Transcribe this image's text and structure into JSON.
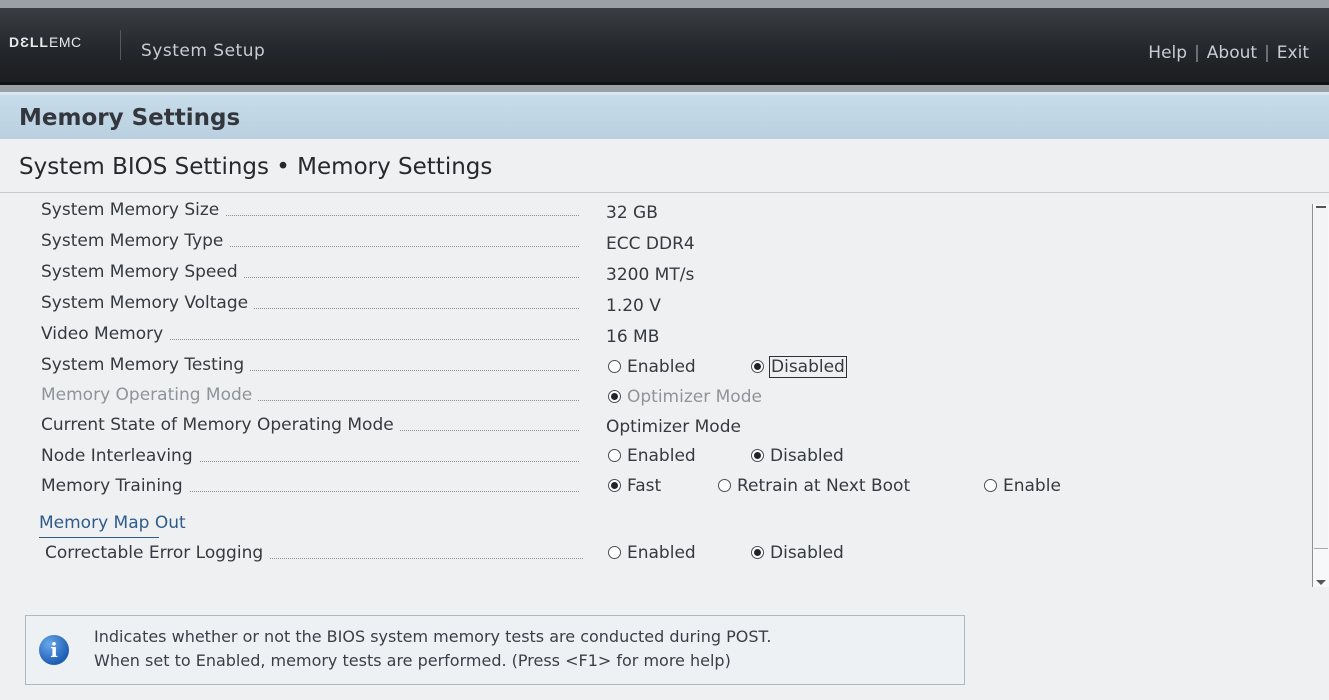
{
  "header": {
    "brand_dell": "DƐLL",
    "brand_emc": "EMC",
    "app_title": "System Setup",
    "links": {
      "help": "Help",
      "about": "About",
      "exit": "Exit",
      "separator": "|"
    }
  },
  "page": {
    "title": "Memory Settings",
    "breadcrumb": "System BIOS Settings • Memory Settings"
  },
  "settings": [
    {
      "label": "System Memory Size",
      "value": "32 GB"
    },
    {
      "label": "System Memory Type",
      "value": "ECC DDR4"
    },
    {
      "label": "System Memory Speed",
      "value": "3200 MT/s"
    },
    {
      "label": "System Memory Voltage",
      "value": "1.20 V"
    },
    {
      "label": "Video Memory",
      "value": "16 MB"
    },
    {
      "label": "System Memory Testing",
      "options": [
        "Enabled",
        "Disabled"
      ],
      "selected": "Disabled"
    },
    {
      "label": "Memory Operating Mode",
      "options": [
        "Optimizer Mode"
      ],
      "selected": "Optimizer Mode",
      "disabled": true
    },
    {
      "label": "Current State of Memory Operating Mode",
      "value": "Optimizer Mode"
    },
    {
      "label": "Node Interleaving",
      "options": [
        "Enabled",
        "Disabled"
      ],
      "selected": "Disabled"
    },
    {
      "label": "Memory Training",
      "options": [
        "Fast",
        "Retrain at Next Boot",
        "Enable"
      ],
      "selected": "Fast"
    },
    {
      "link": "Memory Map Out"
    },
    {
      "label": "Correctable Error Logging",
      "options": [
        "Enabled",
        "Disabled"
      ],
      "selected": "Disabled"
    }
  ],
  "help": {
    "line1": "Indicates whether or not the BIOS system memory tests are conducted during POST.",
    "line2": "When set to Enabled, memory tests are performed. (Press <F1> for more help)",
    "icon": "info-icon"
  },
  "colors": {
    "title_bar": "#c7dcea",
    "link": "#2e5c8a",
    "header_bg": "#23262a"
  }
}
